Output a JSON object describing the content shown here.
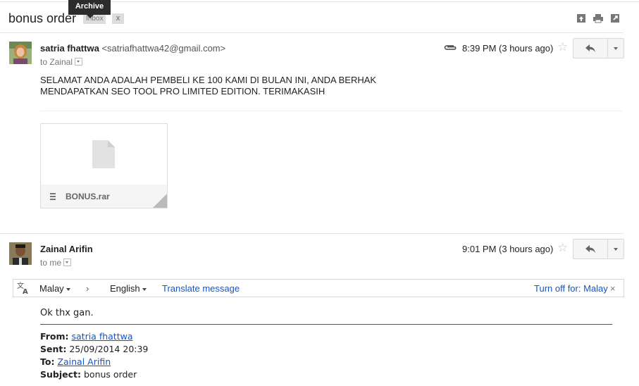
{
  "tooltip": "Archive",
  "thread": {
    "subject": "bonus order",
    "label": "Inbox",
    "label_remove": "x"
  },
  "toolbar_icons": [
    "expand-all-icon",
    "print-icon",
    "new-window-icon"
  ],
  "message1": {
    "sender_name": "satria fhattwa",
    "sender_email": "<satriafhattwa42@gmail.com>",
    "to": "to Zainal",
    "time": "8:39 PM (3 hours ago)",
    "body_line1": "SELAMAT ANDA ADALAH PEMBELI KE 100 KAMI DI BULAN INI, ANDA BERHAK",
    "body_line2": "MENDAPATKAN SEO TOOL PRO LIMITED EDITION. TERIMAKASIH",
    "attachment": {
      "name": "BONUS.rar"
    }
  },
  "message2": {
    "sender_name": "Zainal Arifin",
    "to": "to me",
    "time": "9:01 PM (3 hours ago)",
    "translate": {
      "from_lang": "Malay",
      "arrow": "›",
      "to_lang": "English",
      "action": "Translate message",
      "turn_off": "Turn off for: Malay",
      "close": "×"
    },
    "body": "Ok thx gan.",
    "quoted": {
      "from_label": "From:",
      "from_value": "satria fhattwa",
      "sent_label": "Sent:",
      "sent_value": "25/09/2014 20:39",
      "to_label": "To:",
      "to_value": "Zainal Arifin",
      "subject_label": "Subject:",
      "subject_value": "bonus order"
    }
  },
  "colors": {
    "link": "#1155cc",
    "tooltip_bg": "#2c2c2c",
    "star": "#c6c6c6"
  }
}
